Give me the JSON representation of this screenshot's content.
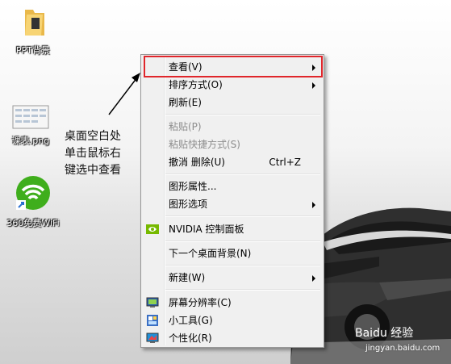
{
  "desktop": {
    "icons": [
      {
        "label": "PPT背景",
        "icon": "folder-icon"
      },
      {
        "label": "课表.png",
        "icon": "image-file-icon"
      },
      {
        "label": "360免费WiFi",
        "icon": "wifi-icon"
      }
    ]
  },
  "annotation": {
    "line1": "桌面空白处",
    "line2": "单击鼠标右",
    "line3": "键选中查看"
  },
  "context_menu": {
    "items": [
      {
        "label": "查看(V)",
        "submenu": true
      },
      {
        "label": "排序方式(O)",
        "submenu": true
      },
      {
        "label": "刷新(E)"
      },
      {
        "label": "粘贴(P)",
        "disabled": true
      },
      {
        "label": "粘贴快捷方式(S)",
        "disabled": true
      },
      {
        "label": "撤消 删除(U)",
        "shortcut": "Ctrl+Z"
      },
      {
        "label": "图形属性..."
      },
      {
        "label": "图形选项",
        "submenu": true
      },
      {
        "label": "NVIDIA 控制面板",
        "icon": "nvidia-icon"
      },
      {
        "label": "下一个桌面背景(N)"
      },
      {
        "label": "新建(W)",
        "submenu": true
      },
      {
        "label": "屏幕分辨率(C)",
        "icon": "display-icon"
      },
      {
        "label": "小工具(G)",
        "icon": "gadgets-icon"
      },
      {
        "label": "个性化(R)",
        "icon": "personalize-icon"
      }
    ]
  },
  "watermark": {
    "logo": "Baidu 经验",
    "url": "jingyan.baidu.com"
  },
  "colors": {
    "highlight_border": "#e0262b",
    "menu_bg": "#f0f0f0"
  }
}
